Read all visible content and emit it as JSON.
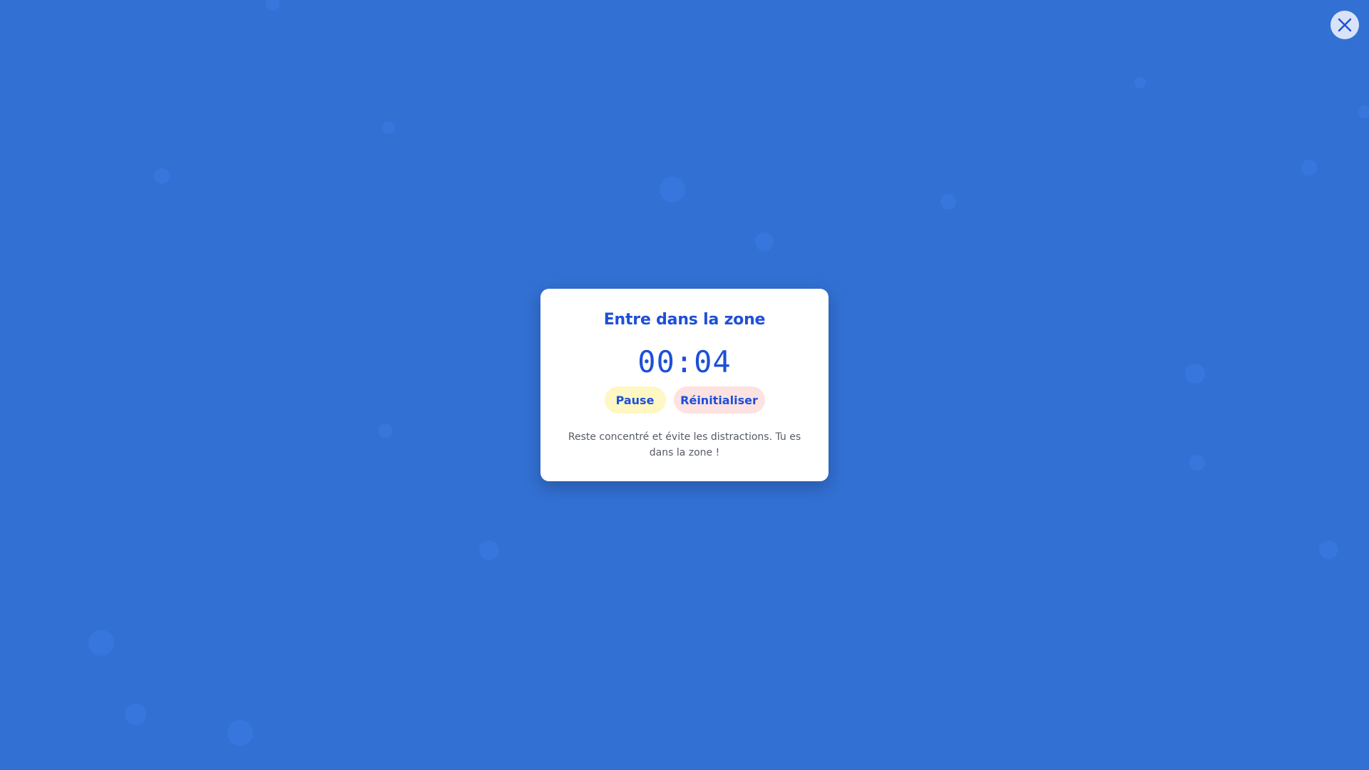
{
  "colors": {
    "background": "#3270d3",
    "accent": "#1d4fd8",
    "pause_button": "#fef7c3",
    "reset_button": "#fde2e2"
  },
  "close": {
    "icon": "close-icon"
  },
  "focus_card": {
    "title": "Entre dans la zone",
    "timer": "00:04",
    "pause_label": "Pause",
    "reset_label": "Réinitialiser",
    "hint": "Reste concentré et évite les distractions. Tu es dans la zone !"
  }
}
